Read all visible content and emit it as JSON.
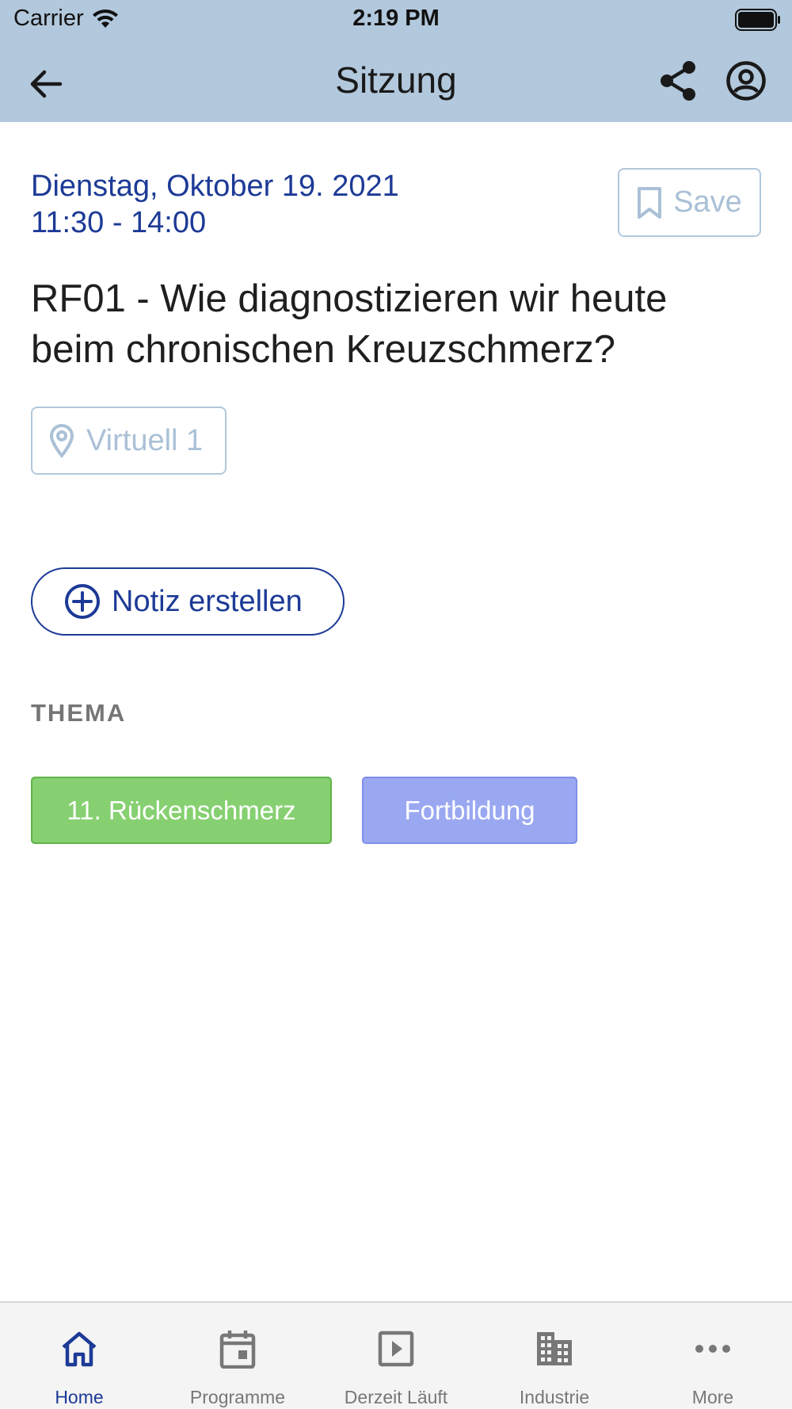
{
  "status_bar": {
    "carrier": "Carrier",
    "time": "2:19 PM"
  },
  "nav": {
    "title": "Sitzung",
    "back_icon": "arrow-left-icon",
    "share_icon": "share-icon",
    "profile_icon": "account-circle-icon"
  },
  "session": {
    "date": "Dienstag, Oktober 19. 2021",
    "time_range": "11:30 - 14:00",
    "title": "RF01 - Wie diagnostizieren wir heute beim chronischen Kreuzschmerz?",
    "location": "Virtuell 1",
    "save_label": "Save",
    "note_label": "Notiz erstellen"
  },
  "topics": {
    "heading": "THEMA",
    "tags": [
      {
        "label": "11. Rückenschmerz",
        "color": "#86d071"
      },
      {
        "label": "Fortbildung",
        "color": "#9aa8f2"
      }
    ]
  },
  "tabbar": {
    "tabs": [
      {
        "label": "Home",
        "icon": "home-icon",
        "active": true
      },
      {
        "label": "Programme",
        "icon": "calendar-icon",
        "active": false
      },
      {
        "label": "Derzeit Läuft",
        "icon": "play-icon",
        "active": false
      },
      {
        "label": "Industrie",
        "icon": "building-icon",
        "active": false
      },
      {
        "label": "More",
        "icon": "more-horizontal-icon",
        "active": false
      }
    ]
  },
  "colors": {
    "header_bg": "#b2c8dc",
    "accent": "#1c3a96",
    "muted": "#aac0d6"
  }
}
